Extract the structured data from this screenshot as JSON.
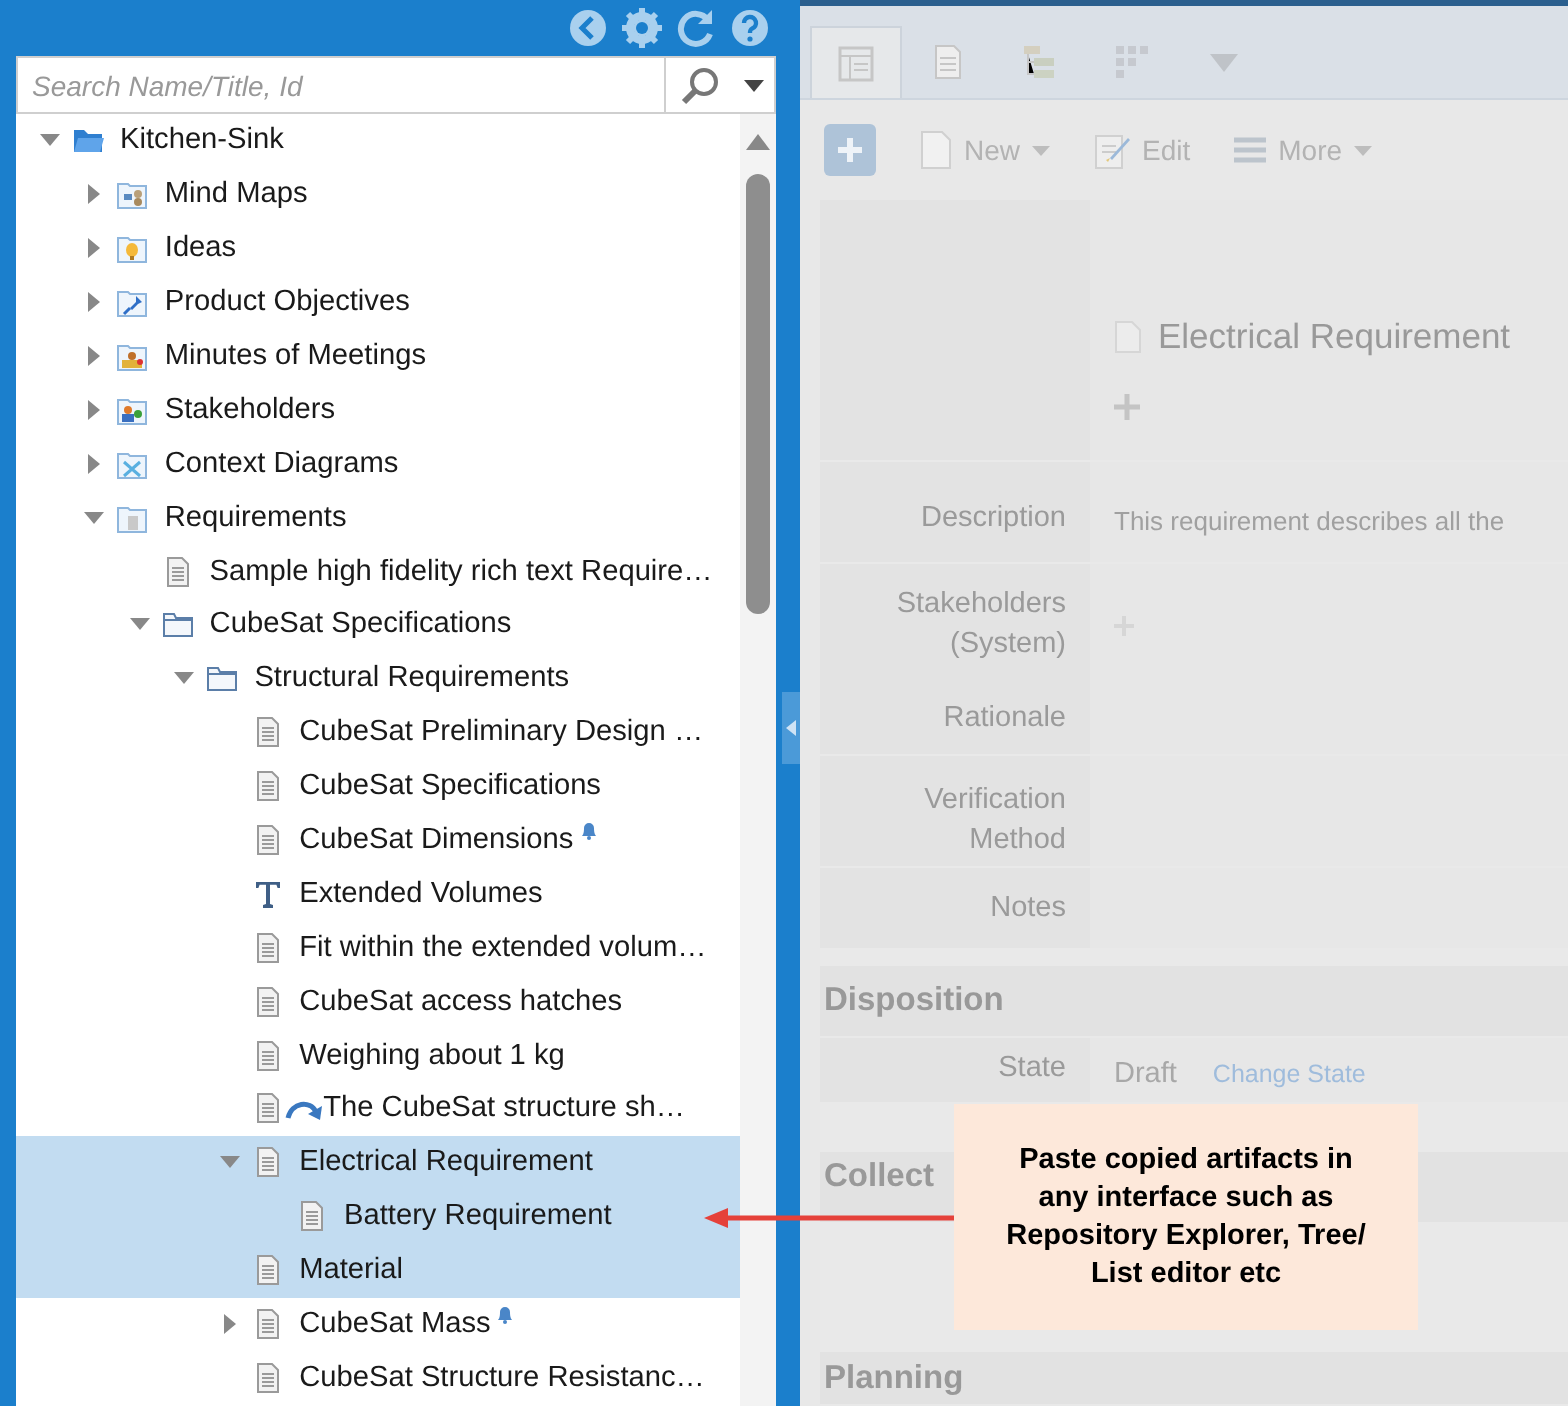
{
  "explorer": {
    "search": {
      "placeholder": "Search Name/Title, Id"
    },
    "tree": [
      {
        "label": "Kitchen-Sink",
        "kind": "root",
        "expanded": true,
        "selected": false,
        "children": [
          {
            "label": "Mind Maps",
            "kind": "mindmaps",
            "expanded": false,
            "selected": false
          },
          {
            "label": "Ideas",
            "kind": "ideas",
            "expanded": false,
            "selected": false
          },
          {
            "label": "Product Objectives",
            "kind": "objectives",
            "expanded": false,
            "selected": false
          },
          {
            "label": "Minutes of Meetings",
            "kind": "meetings",
            "expanded": false,
            "selected": false
          },
          {
            "label": "Stakeholders",
            "kind": "stakeholders",
            "expanded": false,
            "selected": false
          },
          {
            "label": "Context Diagrams",
            "kind": "diagrams",
            "expanded": false,
            "selected": false
          },
          {
            "label": "Requirements",
            "kind": "requirements",
            "expanded": true,
            "selected": false,
            "children": [
              {
                "label": "Sample high fidelity rich text Require…",
                "kind": "document",
                "selected": false
              },
              {
                "label": "CubeSat Specifications",
                "kind": "folder",
                "expanded": true,
                "selected": false,
                "children": [
                  {
                    "label": "Structural Requirements",
                    "kind": "folder",
                    "expanded": true,
                    "selected": false,
                    "children": [
                      {
                        "label": "CubeSat Preliminary Design …",
                        "kind": "document",
                        "selected": false
                      },
                      {
                        "label": "CubeSat Specifications",
                        "kind": "document",
                        "selected": false
                      },
                      {
                        "label": "CubeSat Dimensions",
                        "kind": "document",
                        "selected": false,
                        "bell": true
                      },
                      {
                        "label": "Extended Volumes",
                        "kind": "text",
                        "selected": false
                      },
                      {
                        "label": "Fit within the extended volum…",
                        "kind": "document",
                        "selected": false
                      },
                      {
                        "label": "CubeSat access hatches",
                        "kind": "document",
                        "selected": false
                      },
                      {
                        "label": "Weighing about 1 kg",
                        "kind": "document",
                        "selected": false
                      },
                      {
                        "label": "The CubeSat structure sh…",
                        "kind": "document",
                        "selected": false,
                        "linked": true
                      },
                      {
                        "label": "Electrical Requirement",
                        "kind": "document",
                        "expanded": true,
                        "selected": true,
                        "children": [
                          {
                            "label": "Battery Requirement",
                            "kind": "document",
                            "selected": true
                          }
                        ]
                      },
                      {
                        "label": "Material",
                        "kind": "document",
                        "selected": true
                      },
                      {
                        "label": "CubeSat Mass",
                        "kind": "document",
                        "expanded": false,
                        "selected": false,
                        "bell": true
                      },
                      {
                        "label": "CubeSat Structure Resistanc…",
                        "kind": "document",
                        "selected": false
                      }
                    ]
                  }
                ]
              }
            ]
          }
        ]
      }
    ]
  },
  "detail": {
    "tabs": [
      {
        "kind": "form",
        "selected": true
      },
      {
        "kind": "document",
        "selected": false
      },
      {
        "kind": "tree",
        "selected": false
      },
      {
        "kind": "board",
        "selected": false
      }
    ],
    "toolbar": [
      {
        "label": "New",
        "kind": "menu"
      },
      {
        "label": "Edit",
        "kind": "edit"
      },
      {
        "label": "More",
        "kind": "more"
      }
    ],
    "title": "Electrical Requirement",
    "fields": [
      {
        "label": "Description",
        "value": "This requirement describes all the"
      },
      {
        "label": "Stakeholders (System)",
        "kind": "list"
      },
      {
        "label": "Rationale"
      },
      {
        "label": "Verification Method"
      },
      {
        "label": "Notes"
      }
    ],
    "sections": [
      {
        "title": "Disposition",
        "fields": [
          {
            "label": "State",
            "value": "Draft",
            "action": "Change State"
          }
        ]
      },
      {
        "title": "Collect"
      },
      {
        "title": "Planning"
      }
    ]
  },
  "callout": {
    "text": "Paste copied artifacts in any interface such as Repository Explorer, Tree/ List editor etc"
  }
}
